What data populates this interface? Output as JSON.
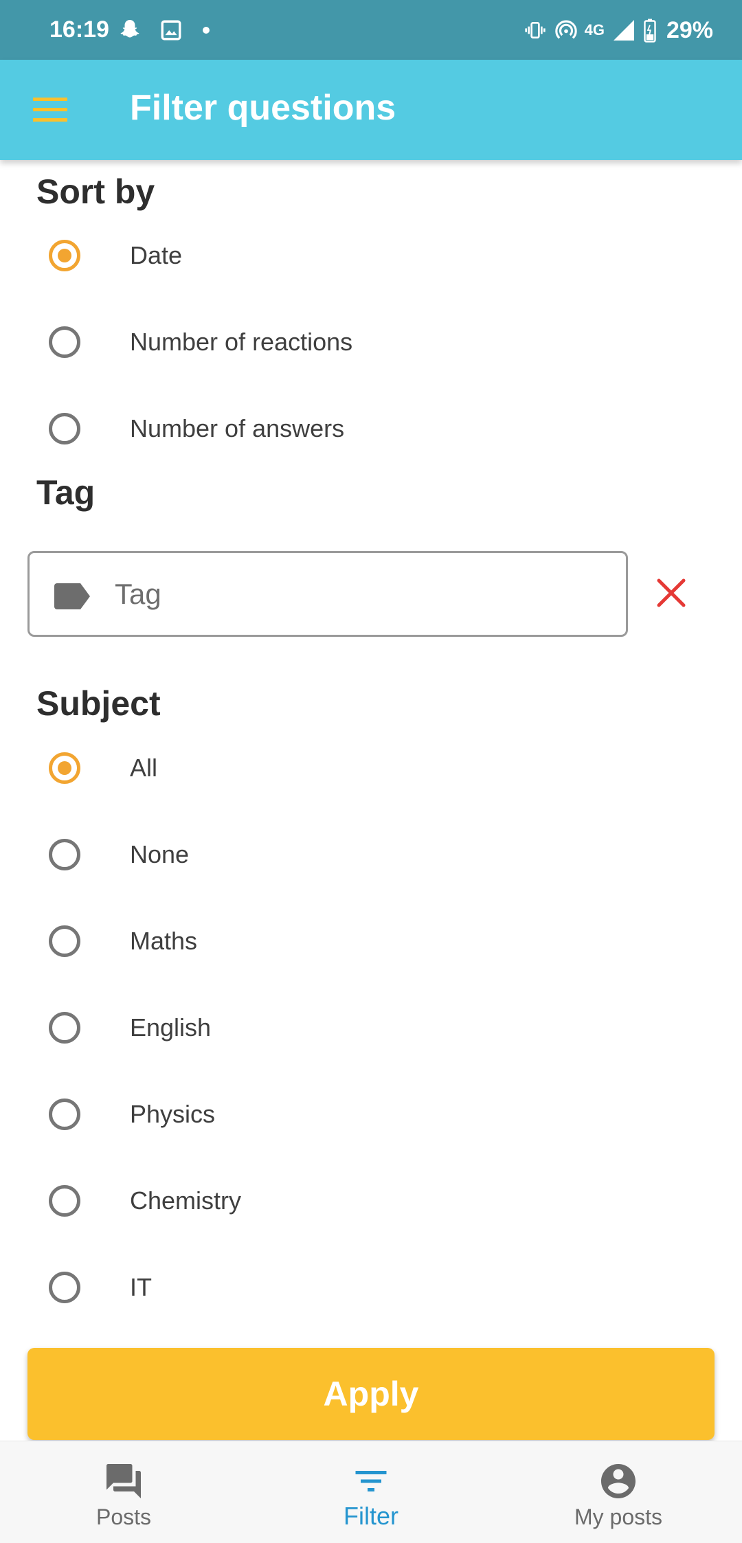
{
  "status_bar": {
    "time": "16:19",
    "battery": "29%",
    "network": "4G"
  },
  "app_bar": {
    "title": "Filter questions"
  },
  "sort_by": {
    "title": "Sort by",
    "options": [
      {
        "label": "Date",
        "selected": true
      },
      {
        "label": "Number of reactions",
        "selected": false
      },
      {
        "label": "Number of answers",
        "selected": false
      }
    ]
  },
  "tag": {
    "title": "Tag",
    "placeholder": "Tag",
    "value": ""
  },
  "subject": {
    "title": "Subject",
    "options": [
      {
        "label": "All",
        "selected": true
      },
      {
        "label": "None",
        "selected": false
      },
      {
        "label": "Maths",
        "selected": false
      },
      {
        "label": "English",
        "selected": false
      },
      {
        "label": "Physics",
        "selected": false
      },
      {
        "label": "Chemistry",
        "selected": false
      },
      {
        "label": "IT",
        "selected": false
      }
    ]
  },
  "apply_label": "Apply",
  "bottom_nav": {
    "items": [
      {
        "label": "Posts",
        "icon": "chat-bubbles-icon",
        "active": false
      },
      {
        "label": "Filter",
        "icon": "filter-icon",
        "active": true
      },
      {
        "label": "My posts",
        "icon": "account-circle-icon",
        "active": false
      }
    ]
  },
  "colors": {
    "status_bar": "#4397a9",
    "app_bar": "#54cbe2",
    "accent": "#f2a531",
    "apply_button": "#fbc02d",
    "clear_icon": "#e53935",
    "nav_active": "#2595cf"
  }
}
